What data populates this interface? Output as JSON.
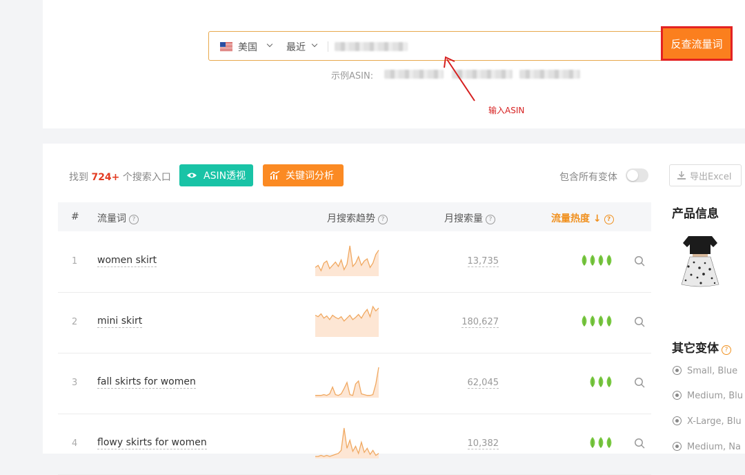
{
  "search": {
    "country": "美国",
    "period": "最近",
    "button_label": "反查流量词",
    "example_label": "示例ASIN:",
    "annotation": "输入ASIN"
  },
  "toolbar": {
    "found_prefix": "找到",
    "found_count": "724+",
    "found_suffix": "个搜索入口",
    "asin_button": "ASIN透视",
    "keyword_button": "关键词分析",
    "variant_toggle_label": "包含所有变体",
    "export_label": "导出Excel"
  },
  "table": {
    "headers": {
      "index": "#",
      "keyword": "流量词",
      "trend": "月搜索趋势",
      "volume": "月搜索量",
      "heat": "流量热度"
    },
    "rows": [
      {
        "index": "1",
        "keyword": "women skirt",
        "volume": "13,735",
        "heat": 4,
        "trend": [
          8,
          10,
          5,
          12,
          14,
          7,
          10,
          13,
          9,
          15,
          6,
          11,
          28,
          9,
          12,
          18,
          10,
          14,
          16,
          8,
          12,
          20,
          24
        ]
      },
      {
        "index": "2",
        "keyword": "mini skirt",
        "volume": "180,627",
        "heat": 4,
        "trend": [
          30,
          28,
          32,
          26,
          29,
          24,
          30,
          27,
          25,
          28,
          22,
          26,
          30,
          24,
          27,
          31,
          26,
          33,
          38,
          28,
          42,
          36,
          40
        ]
      },
      {
        "index": "3",
        "keyword": "fall skirts for women",
        "volume": "62,045",
        "heat": 3,
        "trend": [
          3,
          3,
          3,
          4,
          3,
          5,
          14,
          4,
          3,
          5,
          12,
          20,
          4,
          3,
          18,
          22,
          5,
          4,
          3,
          3,
          4,
          18,
          40
        ]
      },
      {
        "index": "4",
        "keyword": "flowy skirts for women",
        "volume": "10,382",
        "heat": 3,
        "trend": [
          2,
          2,
          3,
          2,
          3,
          2,
          3,
          4,
          5,
          8,
          30,
          10,
          18,
          7,
          12,
          5,
          16,
          6,
          10,
          4,
          8,
          3,
          5
        ]
      }
    ]
  },
  "sidebar": {
    "product_title": "产品信息",
    "variants_title": "其它变体",
    "variants": [
      "Small, Blue",
      "Medium, Blu",
      "X-Large, Blu",
      "Medium, Na"
    ]
  },
  "colors": {
    "accent_orange": "#fb7f1e",
    "teal": "#19c3a6",
    "leaf_green": "#7ac943",
    "spark_line": "#f0a860",
    "spark_fill": "#fde6d4"
  }
}
